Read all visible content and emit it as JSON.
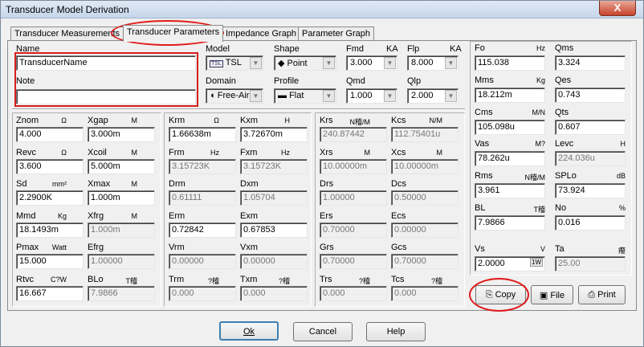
{
  "window": {
    "title": "Transducer Model Derivation",
    "close_label": "X"
  },
  "tabs": [
    "Transducer Measurements",
    "Transducer Parameters",
    "Impedance Graph",
    "Parameter Graph"
  ],
  "name_section": {
    "name_label": "Name",
    "name_value": "TransducerName",
    "note_label": "Note",
    "note_value": ""
  },
  "model": {
    "model_label": "Model",
    "model_value": "TSL",
    "model_icon": "TSL",
    "shape_label": "Shape",
    "shape_value": "Point",
    "fmd_label": "Fmd",
    "fmd_unit": "KA",
    "fmd_value": "3.000",
    "flp_label": "Flp",
    "flp_unit": "KA",
    "flp_value": "8.000",
    "domain_label": "Domain",
    "domain_value": "Free-Air",
    "profile_label": "Profile",
    "profile_value": "Flat",
    "qmd_label": "Qmd",
    "qmd_value": "1.000",
    "qlp_label": "Qlp",
    "qlp_value": "2.000"
  },
  "col1": [
    {
      "label": "Znom",
      "unit": "Ω",
      "value": "4.000",
      "ro": false
    },
    {
      "label": "Revc",
      "unit": "Ω",
      "value": "3.600",
      "ro": false
    },
    {
      "label": "Sd",
      "unit": "mm²",
      "value": "2.2900K",
      "ro": false
    },
    {
      "label": "Mmd",
      "unit": "Kg",
      "value": "18.1493m",
      "ro": false
    },
    {
      "label": "Pmax",
      "unit": "Watt",
      "value": "15.000",
      "ro": false
    },
    {
      "label": "Rtvc",
      "unit": "C?W",
      "value": "16.667",
      "ro": false
    }
  ],
  "col2": [
    {
      "label": "Xgap",
      "unit": "M",
      "value": "3.000m",
      "ro": false
    },
    {
      "label": "Xcoil",
      "unit": "M",
      "value": "5.000m",
      "ro": false
    },
    {
      "label": "Xmax",
      "unit": "M",
      "value": "1.000m",
      "ro": false
    },
    {
      "label": "Xfrg",
      "unit": "M",
      "value": "1.000m",
      "ro": true
    },
    {
      "label": "Efrg",
      "unit": "",
      "value": "1.00000",
      "ro": true
    },
    {
      "label": "BLo",
      "unit": "T稽",
      "value": "7.9866",
      "ro": true
    }
  ],
  "col3": [
    {
      "label": "Krm",
      "unit": "Ω",
      "value": "1.66638m",
      "ro": false
    },
    {
      "label": "Frm",
      "unit": "Hz",
      "value": "3.15723K",
      "ro": true
    },
    {
      "label": "Drm",
      "unit": "",
      "value": "0.61111",
      "ro": true
    },
    {
      "label": "Erm",
      "unit": "",
      "value": "0.72842",
      "ro": false
    },
    {
      "label": "Vrm",
      "unit": "",
      "value": "0.00000",
      "ro": true
    },
    {
      "label": "Trm",
      "unit": "?稽",
      "value": "0.000",
      "ro": true
    }
  ],
  "col4": [
    {
      "label": "Kxm",
      "unit": "H",
      "value": "3.72670m",
      "ro": false
    },
    {
      "label": "Fxm",
      "unit": "Hz",
      "value": "3.15723K",
      "ro": true
    },
    {
      "label": "Dxm",
      "unit": "",
      "value": "1.05704",
      "ro": true
    },
    {
      "label": "Exm",
      "unit": "",
      "value": "0.67853",
      "ro": false
    },
    {
      "label": "Vxm",
      "unit": "",
      "value": "0.00000",
      "ro": true
    },
    {
      "label": "Txm",
      "unit": "?稽",
      "value": "0.000",
      "ro": true
    }
  ],
  "col5": [
    {
      "label": "Krs",
      "unit": "N稽/M",
      "value": "240.87442",
      "ro": true
    },
    {
      "label": "Xrs",
      "unit": "M",
      "value": "10.00000m",
      "ro": true
    },
    {
      "label": "Drs",
      "unit": "",
      "value": "1.00000",
      "ro": true
    },
    {
      "label": "Ers",
      "unit": "",
      "value": "0.70000",
      "ro": true
    },
    {
      "label": "Grs",
      "unit": "",
      "value": "0.70000",
      "ro": true
    },
    {
      "label": "Trs",
      "unit": "?稽",
      "value": "0.000",
      "ro": true
    }
  ],
  "col6": [
    {
      "label": "Kcs",
      "unit": "N/M",
      "value": "112.75401u",
      "ro": true
    },
    {
      "label": "Xcs",
      "unit": "M",
      "value": "10.00000m",
      "ro": true
    },
    {
      "label": "Dcs",
      "unit": "",
      "value": "0.50000",
      "ro": true
    },
    {
      "label": "Ecs",
      "unit": "",
      "value": "0.00000",
      "ro": true
    },
    {
      "label": "Gcs",
      "unit": "",
      "value": "0.70000",
      "ro": true
    },
    {
      "label": "Tcs",
      "unit": "?稽",
      "value": "0.000",
      "ro": true
    }
  ],
  "right_left": [
    {
      "label": "Fo",
      "unit": "Hz",
      "value": "115.038",
      "ro": false
    },
    {
      "label": "Mms",
      "unit": "Kg",
      "value": "18.212m",
      "ro": false
    },
    {
      "label": "Cms",
      "unit": "M/N",
      "value": "105.098u",
      "ro": false
    },
    {
      "label": "Vas",
      "unit": "M?",
      "value": "78.262u",
      "ro": false
    },
    {
      "label": "Rms",
      "unit": "N稽/M",
      "value": "3.961",
      "ro": false
    },
    {
      "label": "BL",
      "unit": "T稽",
      "value": "7.9866",
      "ro": false
    }
  ],
  "right_right": [
    {
      "label": "Qms",
      "unit": "",
      "value": "3.324",
      "ro": false
    },
    {
      "label": "Qes",
      "unit": "",
      "value": "0.743",
      "ro": false
    },
    {
      "label": "Qts",
      "unit": "",
      "value": "0.607",
      "ro": false
    },
    {
      "label": "Levc",
      "unit": "H",
      "value": "224.036u",
      "ro": true
    },
    {
      "label": "SPLo",
      "unit": "dB",
      "value": "73.924",
      "ro": false
    },
    {
      "label": "No",
      "unit": "%",
      "value": "0.016",
      "ro": false
    }
  ],
  "vs": {
    "label": "Vs",
    "unit": "V",
    "value": "2.0000",
    "spin": "1W"
  },
  "ta": {
    "label": "Ta",
    "unit": "癈",
    "value": "25.00"
  },
  "action_buttons": {
    "copy": "Copy",
    "file": "File",
    "print": "Print"
  },
  "dialog_buttons": {
    "ok": "Ok",
    "cancel": "Cancel",
    "help": "Help"
  }
}
